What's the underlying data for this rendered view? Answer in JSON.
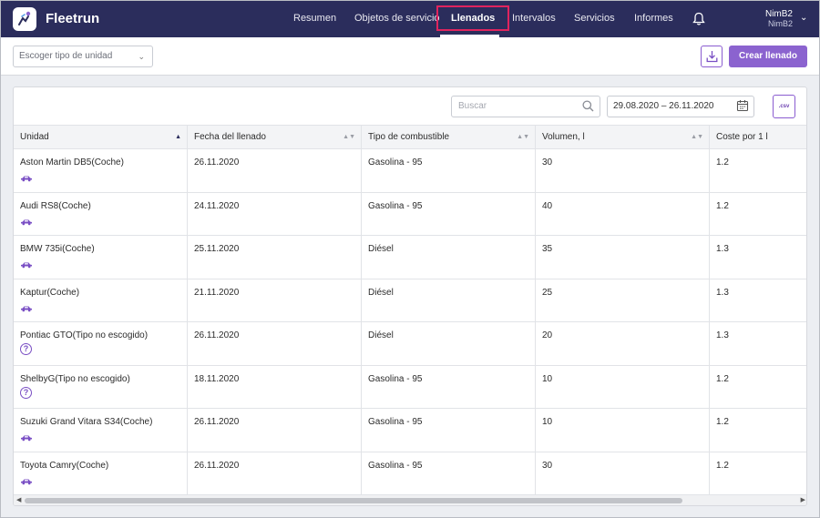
{
  "app": {
    "name": "Fleetrun"
  },
  "nav": {
    "items": [
      {
        "label": "Resumen"
      },
      {
        "label": "Objetos de servicio"
      },
      {
        "label": "Llenados"
      },
      {
        "label": "Intervalos"
      },
      {
        "label": "Servicios"
      },
      {
        "label": "Informes"
      }
    ],
    "active": "Llenados"
  },
  "user": {
    "name": "NimB2",
    "account": "NimB2"
  },
  "toolbar": {
    "unit_type_placeholder": "Escoger tipo de unidad",
    "create_label": "Crear llenado"
  },
  "filters": {
    "search_placeholder": "Buscar",
    "date_range": "29.08.2020 – 26.11.2020",
    "csv_label": ".csv"
  },
  "table": {
    "columns": [
      "Unidad",
      "Fecha del llenado",
      "Tipo de combustible",
      "Volumen, l",
      "Coste por 1 l"
    ],
    "rows": [
      {
        "unit": "Aston Martin DB5(Coche)",
        "icon": "car-icon",
        "date": "26.11.2020",
        "fuel": "Gasolina - 95",
        "volume": "30",
        "cost": "1.2"
      },
      {
        "unit": "Audi RS8(Coche)",
        "icon": "car-icon",
        "date": "24.11.2020",
        "fuel": "Gasolina - 95",
        "volume": "40",
        "cost": "1.2"
      },
      {
        "unit": "BMW 735i(Coche)",
        "icon": "car-icon",
        "date": "25.11.2020",
        "fuel": "Diésel",
        "volume": "35",
        "cost": "1.3"
      },
      {
        "unit": "Kaptur(Coche)",
        "icon": "car-icon",
        "date": "21.11.2020",
        "fuel": "Diésel",
        "volume": "25",
        "cost": "1.3"
      },
      {
        "unit": "Pontiac GTO(Tipo no escogido)",
        "icon": "question-icon",
        "date": "26.11.2020",
        "fuel": "Diésel",
        "volume": "20",
        "cost": "1.3"
      },
      {
        "unit": "ShelbyG(Tipo no escogido)",
        "icon": "question-icon",
        "date": "18.11.2020",
        "fuel": "Gasolina - 95",
        "volume": "10",
        "cost": "1.2"
      },
      {
        "unit": "Suzuki Grand Vitara S34(Coche)",
        "icon": "car-icon",
        "date": "26.11.2020",
        "fuel": "Gasolina - 95",
        "volume": "10",
        "cost": "1.2"
      },
      {
        "unit": "Toyota Camry(Coche)",
        "icon": "car-icon",
        "date": "26.11.2020",
        "fuel": "Gasolina - 95",
        "volume": "30",
        "cost": "1.2"
      }
    ]
  },
  "colors": {
    "topbar": "#2b2d5c",
    "accent": "#8b63cf",
    "active_outline": "#e0245e"
  }
}
